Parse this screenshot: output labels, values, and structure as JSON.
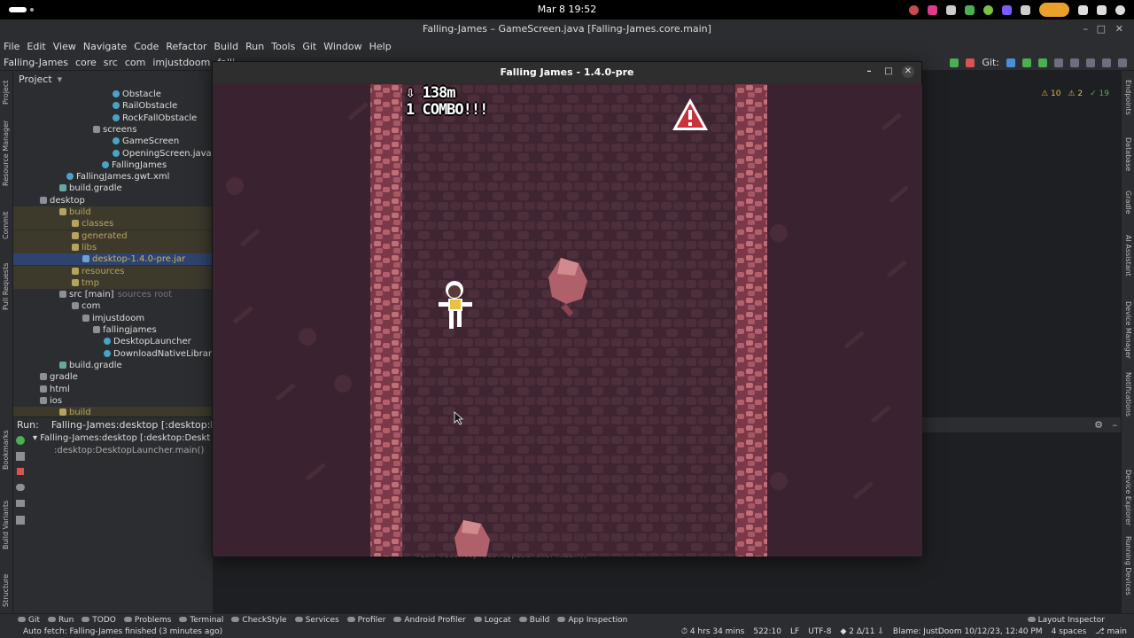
{
  "topbar": {
    "clock": "Mar 8  19:52"
  },
  "ide": {
    "title": "Falling-James – GameScreen.java [Falling-James.core.main]",
    "menu": [
      "File",
      "Edit",
      "View",
      "Navigate",
      "Code",
      "Refactor",
      "Build",
      "Run",
      "Tools",
      "Git",
      "Window",
      "Help"
    ],
    "breadcrumb": [
      "Falling-James",
      "core",
      "src",
      "com",
      "imjustdoom",
      "falli"
    ],
    "git_label": "Git:"
  },
  "project": {
    "header": "Project",
    "tree": [
      {
        "label": "Obstacle",
        "icon": "java"
      },
      {
        "label": "RailObstacle",
        "icon": "java"
      },
      {
        "label": "RockFallObstacle",
        "icon": "java"
      },
      {
        "label": "screens",
        "icon": "folder"
      },
      {
        "label": "GameScreen",
        "icon": "java"
      },
      {
        "label": "OpeningScreen.java",
        "icon": "java"
      },
      {
        "label": "FallingJames",
        "icon": "java"
      },
      {
        "label": "FallingJames.gwt.xml",
        "icon": "xml"
      },
      {
        "label": "build.gradle",
        "icon": "gradle"
      },
      {
        "label": "desktop",
        "icon": "folder"
      },
      {
        "label": "build",
        "icon": "folder-excluded"
      },
      {
        "label": "classes",
        "icon": "folder-excluded"
      },
      {
        "label": "generated",
        "icon": "folder-excluded"
      },
      {
        "label": "libs",
        "icon": "folder-excluded"
      },
      {
        "label": "desktop-1.4.0-pre.jar",
        "icon": "jar"
      },
      {
        "label": "resources",
        "icon": "folder-excluded"
      },
      {
        "label": "tmp",
        "icon": "folder-excluded"
      },
      {
        "label": "src [main]",
        "icon": "folder",
        "suffix": "sources root"
      },
      {
        "label": "com",
        "icon": "folder"
      },
      {
        "label": "imjustdoom",
        "icon": "folder"
      },
      {
        "label": "fallingjames",
        "icon": "folder"
      },
      {
        "label": "DesktopLauncher",
        "icon": "java"
      },
      {
        "label": "DownloadNativeLibrary",
        "icon": "java"
      },
      {
        "label": "build.gradle",
        "icon": "gradle"
      },
      {
        "label": "gradle",
        "icon": "folder"
      },
      {
        "label": "html",
        "icon": "folder"
      },
      {
        "label": "ios",
        "icon": "folder"
      },
      {
        "label": "build",
        "icon": "folder-excluded"
      }
    ]
  },
  "inspections": {
    "warnings": "10",
    "weak": "2",
    "typos": "19"
  },
  "run": {
    "label": "Run:",
    "tab": "Falling-James:desktop [:desktop:Desktop",
    "tree": [
      "Falling-James:desktop [:desktop:Deskt",
      ":desktop:DesktopLauncher.main()"
    ],
    "console": "> Task :desktop:DesktopLauncher.main()"
  },
  "left_strip": [
    "Project",
    "Resource Manager",
    "Commit",
    "Pull Requests",
    "Bookmarks",
    "Build Variants",
    "Structure"
  ],
  "right_strip": [
    "Endpoints",
    "Database",
    "Gradle",
    "AI Assistant",
    "Device Manager",
    "Notifications",
    "Device Explorer",
    "Running Devices"
  ],
  "bottom_tabs": [
    "Git",
    "Run",
    "TODO",
    "Problems",
    "Terminal",
    "CheckStyle",
    "Services",
    "Profiler",
    "Android Profiler",
    "Logcat",
    "Build",
    "App Inspection",
    "Layout Inspector"
  ],
  "status": {
    "message": "Auto fetch: Falling-James finished (3 minutes ago)",
    "time": "4 hrs 34 mins",
    "position": "522:10",
    "line_sep": "LF",
    "encoding": "UTF-8",
    "vcs": "2 Δ/11 ⇩",
    "blame": "Blame: JustDoom 10/12/23, 12:40 PM",
    "indent": "4 spaces",
    "branch": "main"
  },
  "game": {
    "title": "Falling James - 1.4.0-pre",
    "distance": "138m",
    "combo": "1 COMBO!!!"
  },
  "colors": {
    "ide_bg": "#2b2d30",
    "game_side": "#3a2430",
    "game_shaft": "#4a2e3a",
    "game_wall": "#b8646e"
  }
}
